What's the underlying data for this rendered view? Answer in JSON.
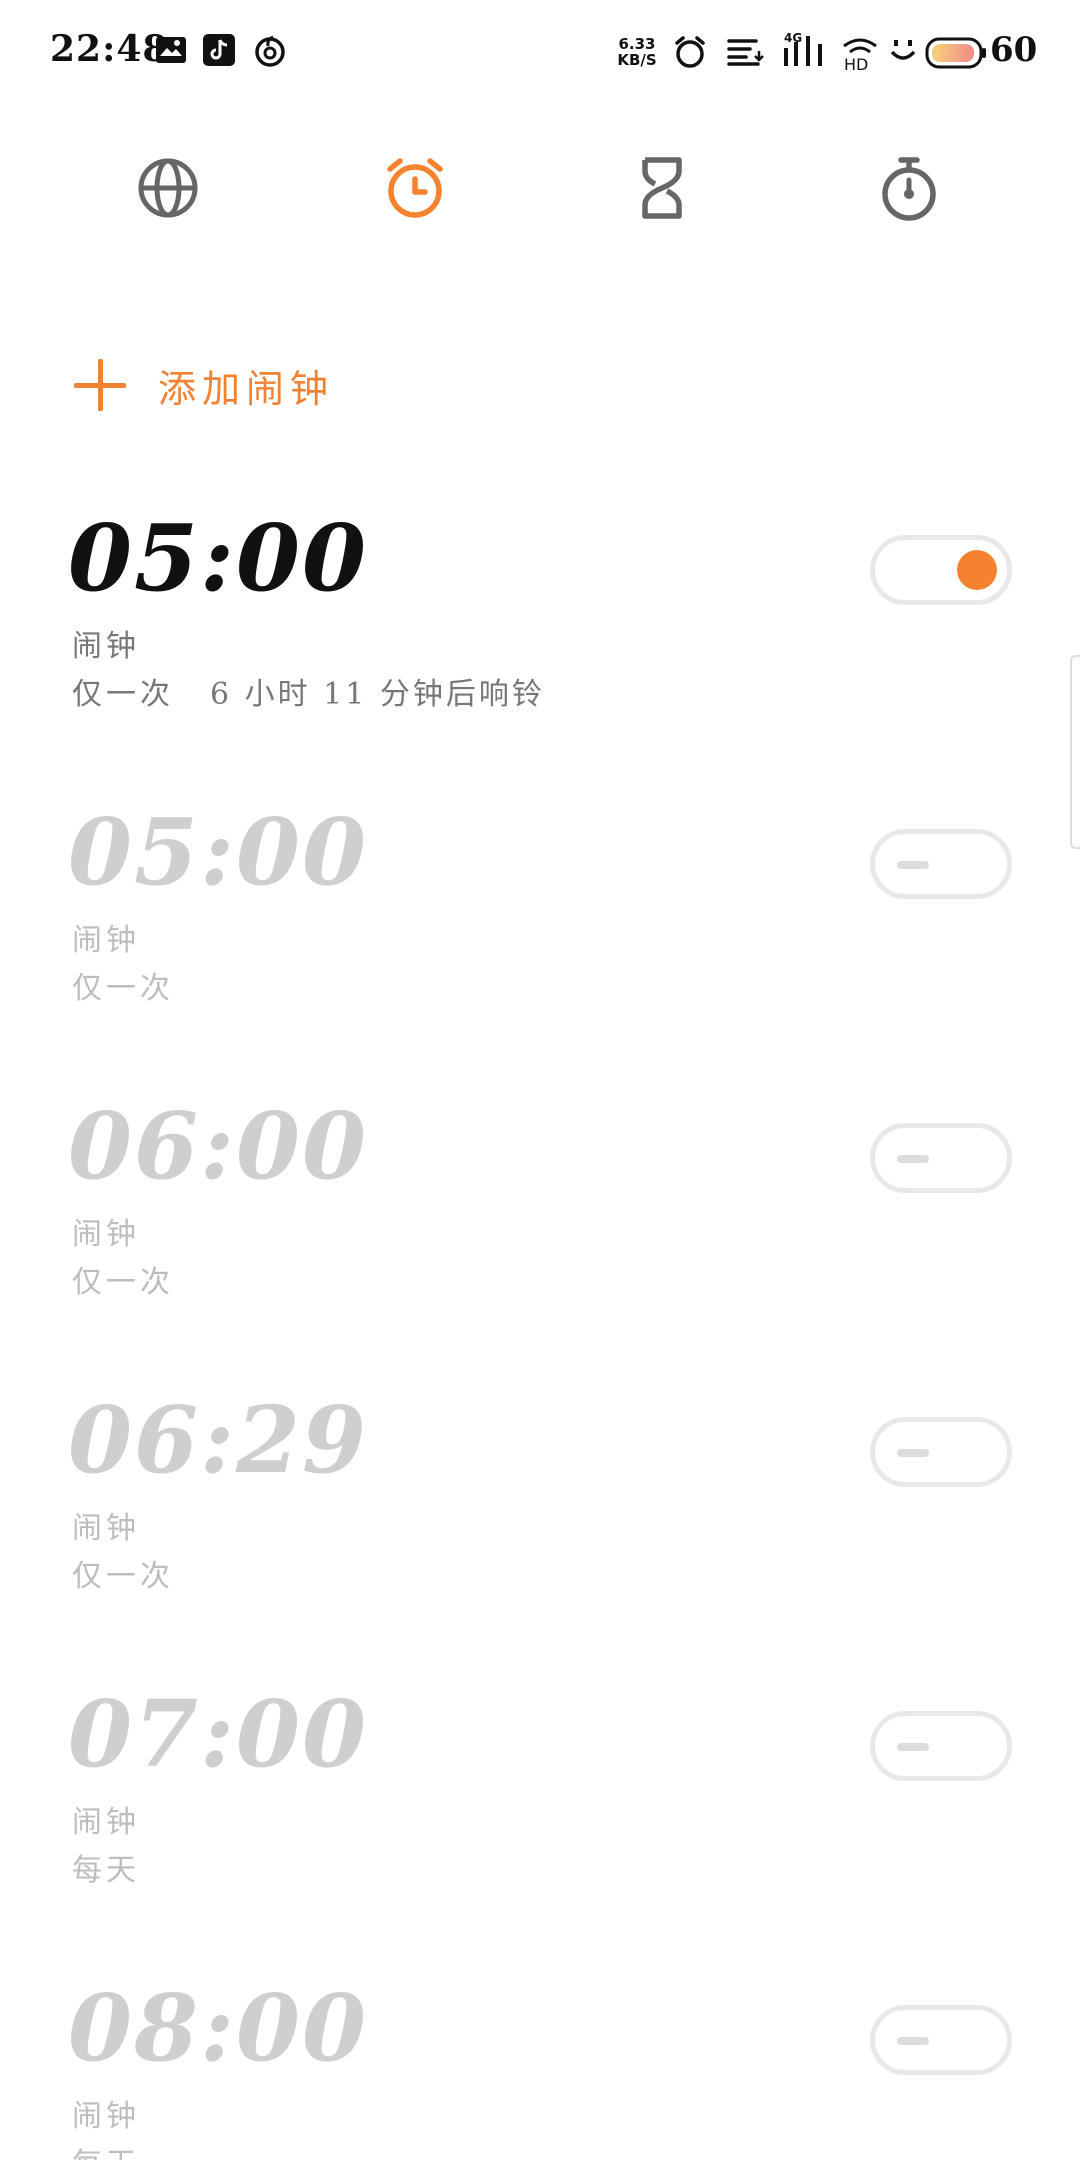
{
  "status_bar": {
    "time": "22:48",
    "network_speed_value": "6.33",
    "network_speed_unit": "KB/S",
    "network_type": "4G",
    "hd_label": "HD",
    "battery_level": "60",
    "left_icons": [
      "gallery-icon",
      "tiktok-icon",
      "netease-music-icon"
    ],
    "right_icons": [
      "alarm-status-icon",
      "notification-icon",
      "signal-icon",
      "wifi-hd-icon",
      "emoji-icon",
      "battery-icon"
    ]
  },
  "tabs": [
    {
      "id": "world-clock",
      "icon": "globe-icon",
      "active": false
    },
    {
      "id": "alarm",
      "icon": "alarm-clock-icon",
      "active": true
    },
    {
      "id": "timer",
      "icon": "hourglass-icon",
      "active": false
    },
    {
      "id": "stopwatch",
      "icon": "stopwatch-icon",
      "active": false
    }
  ],
  "add_alarm": {
    "label": "添加闹钟"
  },
  "alarms": [
    {
      "time": "05:00",
      "name": "闹钟",
      "repeat": "仅一次",
      "remaining": "6 小时 11 分钟后响铃",
      "enabled": true
    },
    {
      "time": "05:00",
      "name": "闹钟",
      "repeat": "仅一次",
      "enabled": false
    },
    {
      "time": "06:00",
      "name": "闹钟",
      "repeat": "仅一次",
      "enabled": false
    },
    {
      "time": "06:29",
      "name": "闹钟",
      "repeat": "仅一次",
      "enabled": false
    },
    {
      "time": "07:00",
      "name": "闹钟",
      "repeat": "每天",
      "enabled": false
    },
    {
      "time": "08:00",
      "name": "闹钟",
      "repeat": "每天",
      "enabled": false
    }
  ],
  "colors": {
    "accent": "#f5822e",
    "text_on": "#111111",
    "text_off": "#cfcfcf",
    "tab_inactive": "#666666"
  }
}
